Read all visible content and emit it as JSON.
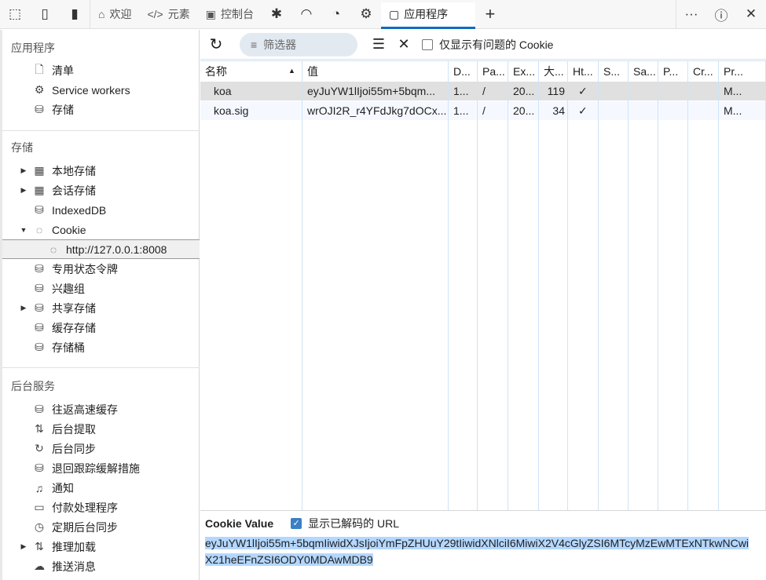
{
  "topbar": {
    "tabs": [
      {
        "label": "欢迎",
        "icon": "home-icon"
      },
      {
        "label": "元素",
        "icon": "code-icon"
      },
      {
        "label": "控制台",
        "icon": "console-icon"
      }
    ],
    "active_tab": "应用程序"
  },
  "sidebar": {
    "sections": [
      {
        "title": "应用程序",
        "items": [
          {
            "label": "清单",
            "icon": "file-icon"
          },
          {
            "label": "Service workers",
            "icon": "gear-icon"
          },
          {
            "label": "存储",
            "icon": "database-icon"
          }
        ]
      },
      {
        "title": "存储",
        "items": [
          {
            "label": "本地存储",
            "icon": "grid-icon",
            "arrow": "▶"
          },
          {
            "label": "会话存储",
            "icon": "grid-icon",
            "arrow": "▶"
          },
          {
            "label": "IndexedDB",
            "icon": "database-icon"
          },
          {
            "label": "Cookie",
            "icon": "cookie-icon",
            "arrow": "▼"
          },
          {
            "label": "http://127.0.0.1:8008",
            "icon": "cookie-icon",
            "child": true,
            "selected": true
          },
          {
            "label": "专用状态令牌",
            "icon": "database-icon"
          },
          {
            "label": "兴趣组",
            "icon": "database-icon"
          },
          {
            "label": "共享存储",
            "icon": "database-icon",
            "arrow": "▶"
          },
          {
            "label": "缓存存储",
            "icon": "database-icon"
          },
          {
            "label": "存储桶",
            "icon": "database-icon"
          }
        ]
      },
      {
        "title": "后台服务",
        "items": [
          {
            "label": "往返高速缓存",
            "icon": "database-icon"
          },
          {
            "label": "后台提取",
            "icon": "arrows-updown-icon"
          },
          {
            "label": "后台同步",
            "icon": "sync-icon"
          },
          {
            "label": "退回跟踪缓解措施",
            "icon": "database-icon"
          },
          {
            "label": "通知",
            "icon": "bell-icon"
          },
          {
            "label": "付款处理程序",
            "icon": "card-icon"
          },
          {
            "label": "定期后台同步",
            "icon": "clock-icon"
          },
          {
            "label": "推理加载",
            "icon": "arrows-updown-icon",
            "arrow": "▶"
          },
          {
            "label": "推送消息",
            "icon": "cloud-icon"
          }
        ]
      }
    ]
  },
  "toolbar": {
    "filter_placeholder": "筛选器",
    "only_issues_label": "仅显示有问题的 Cookie",
    "only_issues_checked": false
  },
  "table": {
    "columns": [
      "名称",
      "值",
      "D...",
      "Pa...",
      "Ex...",
      "大...",
      "Ht...",
      "S...",
      "Sa...",
      "P...",
      "Cr...",
      "Pr..."
    ],
    "sort": "名称 ascending",
    "rows": [
      [
        "koa",
        "eyJuYW1lIjoi55m+5bqm...",
        "1...",
        "/",
        "20...",
        "119",
        "✓",
        "",
        "",
        "",
        "",
        "M..."
      ],
      [
        "koa.sig",
        "wrOJI2R_r4YFdJkg7dOCx...",
        "1...",
        "/",
        "20...",
        "34",
        "✓",
        "",
        "",
        "",
        "",
        "M..."
      ]
    ]
  },
  "detail": {
    "title": "Cookie Value",
    "decode_label": "显示已解码的 URL",
    "decode_checked": true,
    "value": "eyJuYW1lIjoi55m+5bqmIiwidXJsIjoiYmFpZHUuY29tIiwidXNlciI6MiwiX2V4cGlyZSI6MTcyMzEwMTExNTkwNCwiX21heEFnZSI6ODY0MDAwMDB9"
  }
}
